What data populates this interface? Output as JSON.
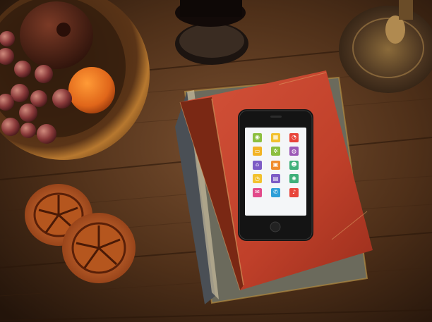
{
  "scene": {
    "description_free": true,
    "colors": {
      "table": "#5a3820",
      "book_cover": "#c8442c",
      "phone_body": "#141414",
      "screen_bg": "#f4f6f8"
    }
  },
  "phone": {
    "apps": [
      {
        "icon": "eye-icon",
        "color": "#8cbf3f",
        "glyph": "◉"
      },
      {
        "icon": "calendar-icon",
        "color": "#f2c12e",
        "glyph": "▦"
      },
      {
        "icon": "rss-icon",
        "color": "#e8443a",
        "glyph": "◔"
      },
      {
        "icon": "chat-icon",
        "color": "#f2b324",
        "glyph": "▭"
      },
      {
        "icon": "gear-icon",
        "color": "#8cbf3f",
        "glyph": "✲"
      },
      {
        "icon": "globe-icon",
        "color": "#9b59b6",
        "glyph": "◍"
      },
      {
        "icon": "bank-icon",
        "color": "#7d5cc6",
        "glyph": "⌂"
      },
      {
        "icon": "photo-icon",
        "color": "#f08c2e",
        "glyph": "▣"
      },
      {
        "icon": "people-icon",
        "color": "#3fb07a",
        "glyph": "☻"
      },
      {
        "icon": "clock-icon",
        "color": "#f2c12e",
        "glyph": "◷"
      },
      {
        "icon": "media-icon",
        "color": "#7d5cc6",
        "glyph": "▤"
      },
      {
        "icon": "settings-icon",
        "color": "#3fb07a",
        "glyph": "✺"
      },
      {
        "icon": "mail-icon",
        "color": "#e24a8a",
        "glyph": "✉"
      },
      {
        "icon": "phone-icon",
        "color": "#2e9fd8",
        "glyph": "✆"
      },
      {
        "icon": "music-icon",
        "color": "#e8443a",
        "glyph": "♪"
      }
    ]
  }
}
